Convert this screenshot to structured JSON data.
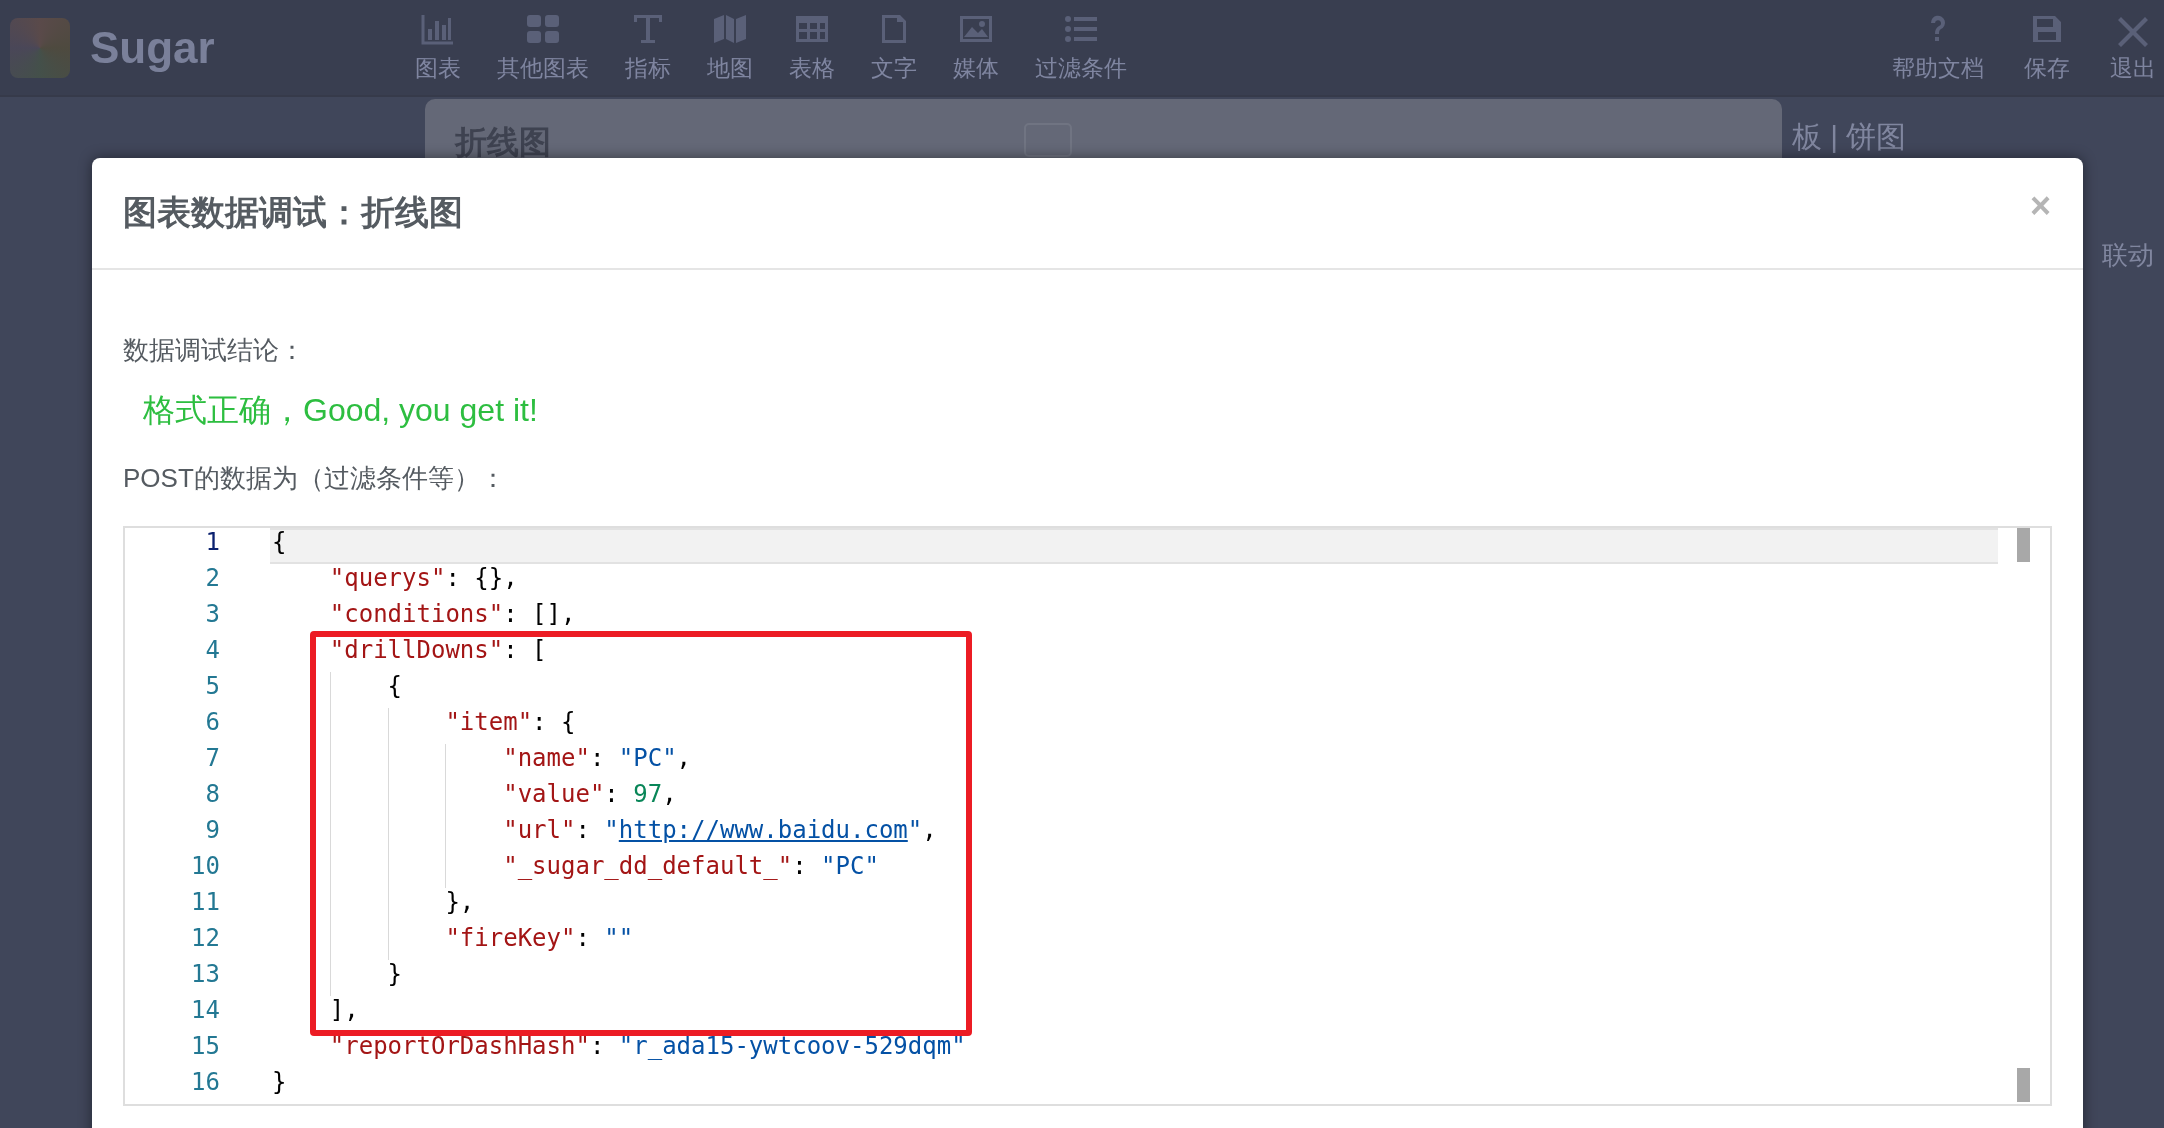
{
  "topbar": {
    "brand": "Sugar",
    "tools": [
      {
        "label": "图表",
        "kind": "bar-chart"
      },
      {
        "label": "其他图表",
        "kind": "grid"
      },
      {
        "label": "指标",
        "kind": "text"
      },
      {
        "label": "地图",
        "kind": "map"
      },
      {
        "label": "表格",
        "kind": "table"
      },
      {
        "label": "文字",
        "kind": "document"
      },
      {
        "label": "媒体",
        "kind": "image"
      },
      {
        "label": "过滤条件",
        "kind": "list"
      }
    ],
    "actions": [
      {
        "label": "帮助文档",
        "kind": "help"
      },
      {
        "label": "保存",
        "kind": "save"
      },
      {
        "label": "退出",
        "kind": "exit"
      }
    ]
  },
  "background": {
    "panel_title": "折线图",
    "side_title": "板 | 饼图",
    "side_label": "联动"
  },
  "modal": {
    "title": "图表数据调试：折线图",
    "close": "×",
    "conclusion_label": "数据调试结论：",
    "conclusion": "格式正确，Good, you get it!",
    "post_label": "POST的数据为（过滤条件等）：",
    "editor": {
      "lines": [
        {
          "number": "1",
          "active": true,
          "tokens": [
            {
              "kind": "punct",
              "text": "{"
            }
          ]
        },
        {
          "number": "2",
          "active": false,
          "tokens": [
            {
              "kind": "key",
              "text": "    \"querys\""
            },
            {
              "kind": "punct",
              "text": ": {},"
            }
          ]
        },
        {
          "number": "3",
          "active": false,
          "tokens": [
            {
              "kind": "key",
              "text": "    \"conditions\""
            },
            {
              "kind": "punct",
              "text": ": [],"
            }
          ]
        },
        {
          "number": "4",
          "active": false,
          "tokens": [
            {
              "kind": "key",
              "text": "    \"drillDowns\""
            },
            {
              "kind": "punct",
              "text": ": ["
            }
          ]
        },
        {
          "number": "5",
          "active": false,
          "tokens": [
            {
              "kind": "punct",
              "text": "        {"
            }
          ]
        },
        {
          "number": "6",
          "active": false,
          "tokens": [
            {
              "kind": "key",
              "text": "            \"item\""
            },
            {
              "kind": "punct",
              "text": ": {"
            }
          ]
        },
        {
          "number": "7",
          "active": false,
          "tokens": [
            {
              "kind": "key",
              "text": "                \"name\""
            },
            {
              "kind": "punct",
              "text": ": "
            },
            {
              "kind": "string",
              "text": "\"PC\""
            },
            {
              "kind": "punct",
              "text": ","
            }
          ]
        },
        {
          "number": "8",
          "active": false,
          "tokens": [
            {
              "kind": "key",
              "text": "                \"value\""
            },
            {
              "kind": "punct",
              "text": ": "
            },
            {
              "kind": "number",
              "text": "97"
            },
            {
              "kind": "punct",
              "text": ","
            }
          ]
        },
        {
          "number": "9",
          "active": false,
          "tokens": [
            {
              "kind": "key",
              "text": "                \"url\""
            },
            {
              "kind": "punct",
              "text": ": "
            },
            {
              "kind": "string",
              "text": "\""
            },
            {
              "kind": "link",
              "text": "http://www.baidu.com"
            },
            {
              "kind": "string",
              "text": "\""
            },
            {
              "kind": "punct",
              "text": ","
            }
          ]
        },
        {
          "number": "10",
          "active": false,
          "tokens": [
            {
              "kind": "key",
              "text": "                \"_sugar_dd_default_\""
            },
            {
              "kind": "punct",
              "text": ": "
            },
            {
              "kind": "string",
              "text": "\"PC\""
            }
          ]
        },
        {
          "number": "11",
          "active": false,
          "tokens": [
            {
              "kind": "punct",
              "text": "            },"
            }
          ]
        },
        {
          "number": "12",
          "active": false,
          "tokens": [
            {
              "kind": "key",
              "text": "            \"fireKey\""
            },
            {
              "kind": "punct",
              "text": ": "
            },
            {
              "kind": "string",
              "text": "\"\""
            }
          ]
        },
        {
          "number": "13",
          "active": false,
          "tokens": [
            {
              "kind": "punct",
              "text": "        }"
            }
          ]
        },
        {
          "number": "14",
          "active": false,
          "tokens": [
            {
              "kind": "punct",
              "text": "    ],"
            }
          ]
        },
        {
          "number": "15",
          "active": false,
          "tokens": [
            {
              "kind": "key",
              "text": "    \"reportOrDashHash\""
            },
            {
              "kind": "punct",
              "text": ": "
            },
            {
              "kind": "string",
              "text": "\"r_ada15-ywtcoov-529dqm\""
            }
          ]
        },
        {
          "number": "16",
          "active": false,
          "tokens": [
            {
              "kind": "punct",
              "text": "}"
            }
          ]
        }
      ]
    }
  }
}
